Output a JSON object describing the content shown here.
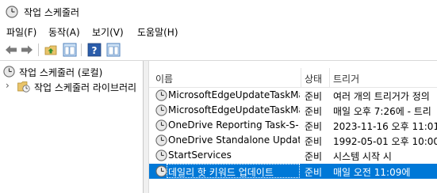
{
  "window": {
    "title": "작업 스케줄러"
  },
  "menu": [
    {
      "label": "파일(F)"
    },
    {
      "label": "동작(A)"
    },
    {
      "label": "보기(V)"
    },
    {
      "label": "도움말(H)"
    }
  ],
  "tree": {
    "root": "작업 스케줄러 (로컬)",
    "library": "작업 스케줄러 라이브러리"
  },
  "list": {
    "columns": {
      "name": "이름",
      "status": "상태",
      "trigger": "트리거"
    },
    "rows": [
      {
        "name": "MicrosoftEdgeUpdateTaskMa...",
        "status": "준비",
        "trigger": "여러 개의 트리거가 정의"
      },
      {
        "name": "MicrosoftEdgeUpdateTaskMa...",
        "status": "준비",
        "trigger": "매일 오후 7:26에 - 트리"
      },
      {
        "name": "OneDrive Reporting Task-S-...",
        "status": "준비",
        "trigger": "2023-11-16 오후 11:01"
      },
      {
        "name": "OneDrive Standalone Updat...",
        "status": "준비",
        "trigger": "1992-05-01 오후 10:00"
      },
      {
        "name": "StartServices",
        "status": "준비",
        "trigger": "시스템 시작 시"
      },
      {
        "name": "데일리 핫 키워드 업데이트",
        "status": "준비",
        "trigger": "매일 오전 11:09에"
      }
    ],
    "selected_index": 5
  },
  "colors": {
    "selection": "#0078d7",
    "accent": "#2a6ebb"
  },
  "icons": [
    "clock-icon",
    "back-arrow-icon",
    "forward-arrow-icon",
    "up-folder-icon",
    "show-hide-pane-icon",
    "help-icon",
    "task-clock-icon",
    "folder-clock-icon"
  ]
}
